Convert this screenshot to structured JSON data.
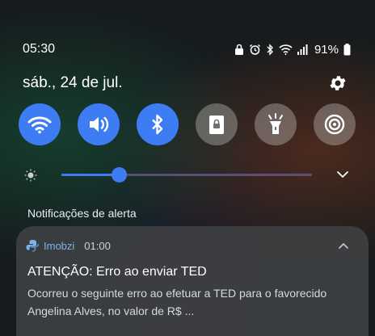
{
  "status_bar": {
    "time": "05:30",
    "battery": "91%",
    "icons": [
      "lock-icon",
      "alarm-icon",
      "bluetooth-icon",
      "wifi-icon",
      "signal-icon",
      "battery-icon"
    ]
  },
  "header": {
    "date": "sáb., 24 de jul."
  },
  "quick_tiles": [
    {
      "icon": "wifi-icon",
      "state": "on"
    },
    {
      "icon": "sound-icon",
      "state": "on"
    },
    {
      "icon": "bluetooth-icon",
      "state": "on"
    },
    {
      "icon": "lock-screen-icon",
      "state": "off"
    },
    {
      "icon": "flashlight-icon",
      "state": "off"
    },
    {
      "icon": "location-icon",
      "state": "off"
    }
  ],
  "brightness": {
    "level": 0.23
  },
  "notifications": {
    "section_label": "Notificações de alerta",
    "items": [
      {
        "app": "Imobzi",
        "time": "01:00",
        "title": "ATENÇÃO: Erro ao enviar TED",
        "body": "Ocorreu o seguinte erro ao efetuar a TED para o favorecido Angelina Alves, no valor de R$ ..."
      }
    ]
  },
  "colors": {
    "accent": "#3d7cf2",
    "app_name": "#7cb3e8"
  }
}
